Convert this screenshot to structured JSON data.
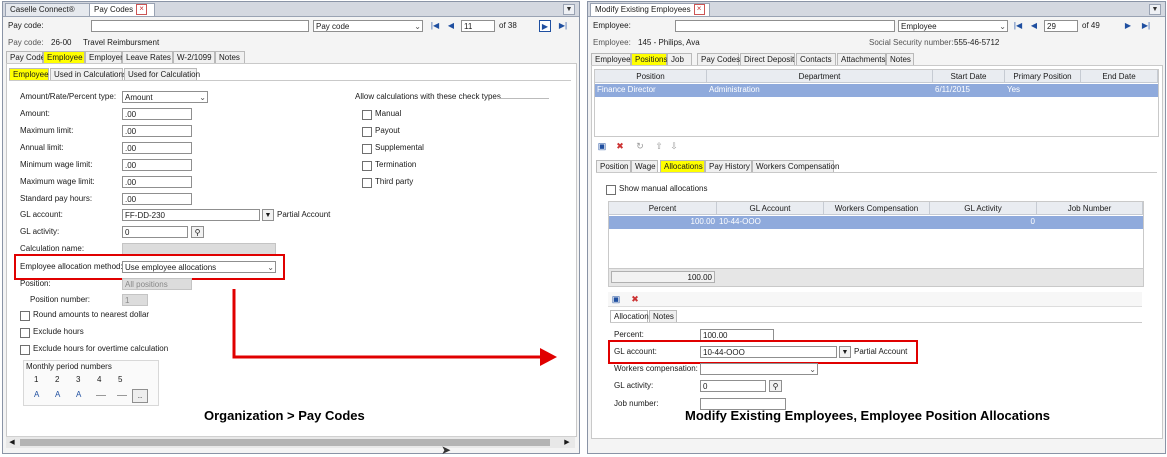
{
  "left": {
    "tabs": [
      "Caselle Connect®",
      "Pay Codes"
    ],
    "lookup": {
      "label": "Pay code:",
      "value": "",
      "select": "Pay code",
      "record": "11",
      "of": "of 38"
    },
    "info": {
      "label": "Pay code:",
      "code": "26-00",
      "name": "Travel Reimbursment"
    },
    "main_tabs": [
      "Pay Code",
      "Employee",
      "Employer",
      "Leave Rates",
      "W-2/1099",
      "Notes"
    ],
    "sub_tabs": [
      "Employee",
      "Used in Calculations",
      "Used for Calculation"
    ],
    "fields": {
      "type_label": "Amount/Rate/Percent type:",
      "type_value": "Amount",
      "amount_label": "Amount:",
      "amount_value": ".00",
      "max_label": "Maximum limit:",
      "max_value": ".00",
      "annual_label": "Annual limit:",
      "annual_value": ".00",
      "minwage_label": "Minimum wage limit:",
      "minwage_value": ".00",
      "maxwage_label": "Maximum wage limit:",
      "maxwage_value": ".00",
      "std_label": "Standard pay hours:",
      "std_value": ".00",
      "gl_label": "GL account:",
      "gl_value": "FF-DD-230",
      "gl_partial": "Partial Account",
      "glact_label": "GL activity:",
      "glact_value": "0",
      "calc_label": "Calculation name:",
      "alloc_label": "Employee allocation method:",
      "alloc_value": "Use employee allocations",
      "position_label": "Position:",
      "position_value": "All positions",
      "posnum_label": "Position number:",
      "posnum_value": "1",
      "round_label": "Round amounts to nearest dollar",
      "exclude_label": "Exclude hours",
      "exclude_ot_label": "Exclude hours for overtime calculation",
      "monthly_label": "Monthly period numbers",
      "monthly_nums": [
        "1",
        "2",
        "3",
        "4",
        "5"
      ],
      "monthly_vals": [
        "A",
        "A",
        "A"
      ],
      "ellipsis": ".."
    },
    "allow": {
      "title": "Allow calculations with these check types",
      "items": [
        "Manual",
        "Payout",
        "Supplemental",
        "Termination",
        "Third party"
      ]
    }
  },
  "right": {
    "tab": "Modify Existing Employees",
    "lookup": {
      "label": "Employee:",
      "value": "",
      "select": "Employee",
      "record": "29",
      "of": "of 49"
    },
    "info": {
      "label": "Employee:",
      "name": "145 - Philips, Ava",
      "ssn_label": "Social Security number:",
      "ssn": "555-46-5712"
    },
    "main_tabs": [
      "Employee",
      "Positions",
      "Job",
      "Pay Codes",
      "Direct Deposit",
      "Contacts",
      "Attachments",
      "Notes"
    ],
    "positions_grid": {
      "headers": [
        "Position",
        "Department",
        "Start Date",
        "Primary Position",
        "End Date"
      ],
      "row": [
        "Finance Director",
        "Administration",
        "6/11/2015",
        "Yes",
        ""
      ]
    },
    "sub_tabs": [
      "Position",
      "Wage",
      "Allocations",
      "Pay History",
      "Workers Compensation"
    ],
    "show_manual": "Show manual allocations",
    "alloc_grid": {
      "headers": [
        "Percent",
        "GL Account",
        "Workers Compensation",
        "GL Activity",
        "Job Number"
      ],
      "row": [
        "100.00",
        "10-44-OOO",
        "",
        "0",
        ""
      ],
      "total": "100.00"
    },
    "detail_tabs": [
      "Allocation",
      "Notes"
    ],
    "detail": {
      "percent_label": "Percent:",
      "percent_value": "100.00",
      "gl_label": "GL account:",
      "gl_value": "10-44-OOO",
      "gl_partial": "Partial Account",
      "wc_label": "Workers compensation:",
      "glact_label": "GL activity:",
      "glact_value": "0",
      "job_label": "Job number:"
    }
  },
  "captions": {
    "left": "Organization > Pay Codes",
    "right": "Modify Existing Employees, Employee Position Allocations"
  },
  "colors": {
    "highlight": "#ffff00",
    "callout": "#e00000",
    "row_selected": "#8faadc"
  }
}
